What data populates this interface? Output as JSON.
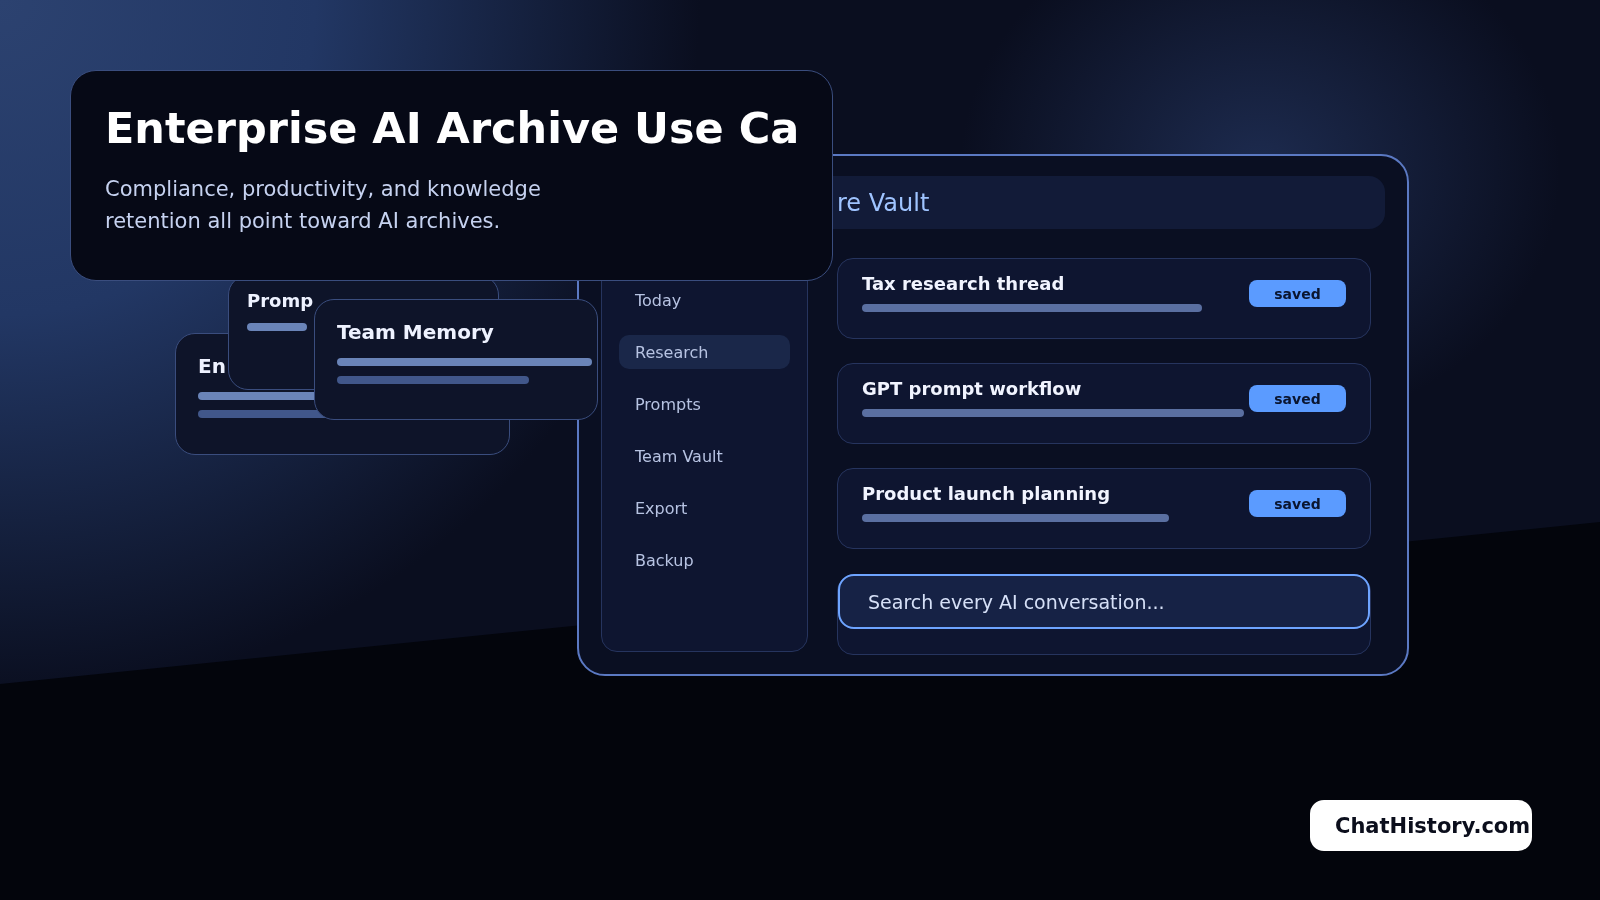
{
  "header_card": {
    "title": "Enterprise AI Archive Use Ca",
    "subtitle": "Compliance, productivity, and knowledge retention all point toward AI archives."
  },
  "floating_cards": [
    {
      "title": "En"
    },
    {
      "title": "Promp"
    },
    {
      "title": "Team Memory"
    }
  ],
  "window": {
    "title": "re Vault",
    "sidebar": {
      "items": [
        {
          "label": "Today",
          "selected": false
        },
        {
          "label": "Research",
          "selected": true
        },
        {
          "label": "Prompts",
          "selected": false
        },
        {
          "label": "Team Vault",
          "selected": false
        },
        {
          "label": "Export",
          "selected": false
        },
        {
          "label": "Backup",
          "selected": false
        }
      ]
    },
    "conversations": [
      {
        "title": "Tax research thread",
        "badge": "saved"
      },
      {
        "title": "GPT prompt workflow",
        "badge": "saved"
      },
      {
        "title": "Product launch planning",
        "badge": "saved"
      }
    ],
    "search": {
      "placeholder": "Search every AI conversation..."
    }
  },
  "brand_badge": "ChatHistory.com"
}
